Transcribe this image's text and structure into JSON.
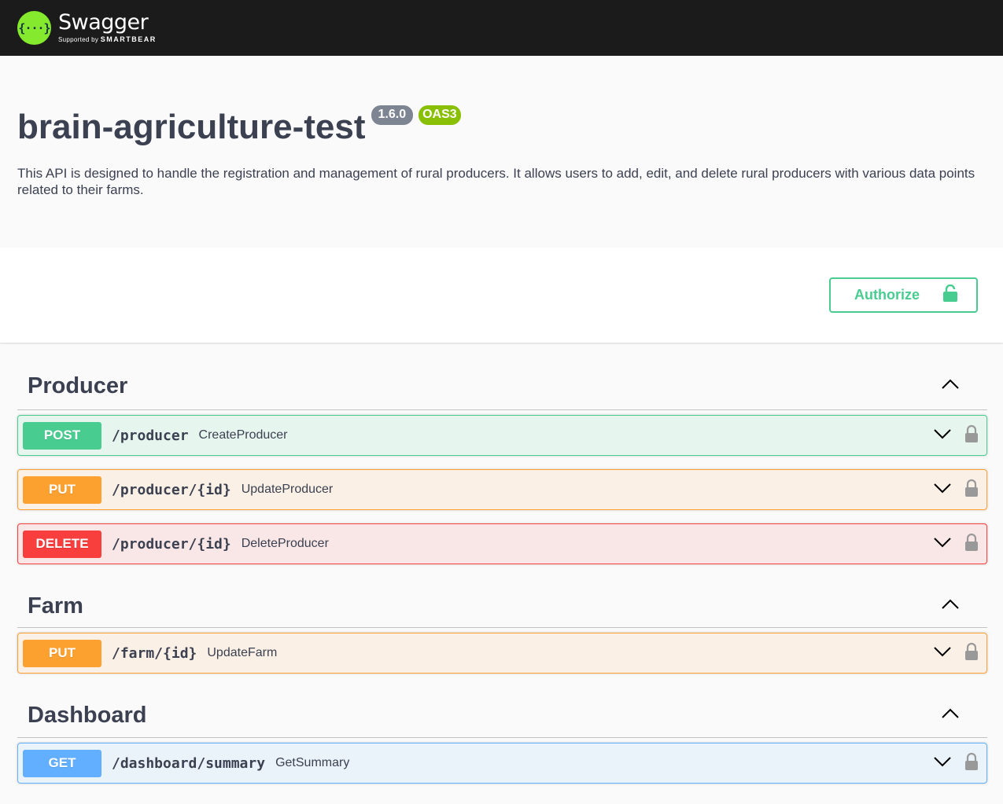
{
  "header": {
    "logo_glyph": "{···}",
    "brand_name": "Swagger",
    "supported_by": "Supported by",
    "company": "SMARTBEAR"
  },
  "info": {
    "title": "brain-agriculture-test",
    "version": "1.6.0",
    "oas": "OAS3",
    "description": "This API is designed to handle the registration and management of rural producers. It allows users to add, edit, and delete rural producers with various data points related to their farms."
  },
  "auth": {
    "label": "Authorize"
  },
  "tags": [
    {
      "name": "Producer",
      "operations": [
        {
          "method": "POST",
          "path": "/producer",
          "summary": "CreateProducer"
        },
        {
          "method": "PUT",
          "path": "/producer/{id}",
          "summary": "UpdateProducer"
        },
        {
          "method": "DELETE",
          "path": "/producer/{id}",
          "summary": "DeleteProducer"
        }
      ]
    },
    {
      "name": "Farm",
      "operations": [
        {
          "method": "PUT",
          "path": "/farm/{id}",
          "summary": "UpdateFarm"
        }
      ]
    },
    {
      "name": "Dashboard",
      "operations": [
        {
          "method": "GET",
          "path": "/dashboard/summary",
          "summary": "GetSummary"
        }
      ]
    }
  ],
  "colors": {
    "post": "#49cc90",
    "put": "#fca130",
    "delete": "#f93e3e",
    "get": "#61affe",
    "version_badge": "#7d8492",
    "oas_badge": "#89bf04"
  },
  "icons": {
    "tag_toggle": "chevron-up-icon",
    "op_toggle": "chevron-down-icon",
    "op_lock": "lock-icon",
    "authorize_lock": "unlocked-icon"
  }
}
